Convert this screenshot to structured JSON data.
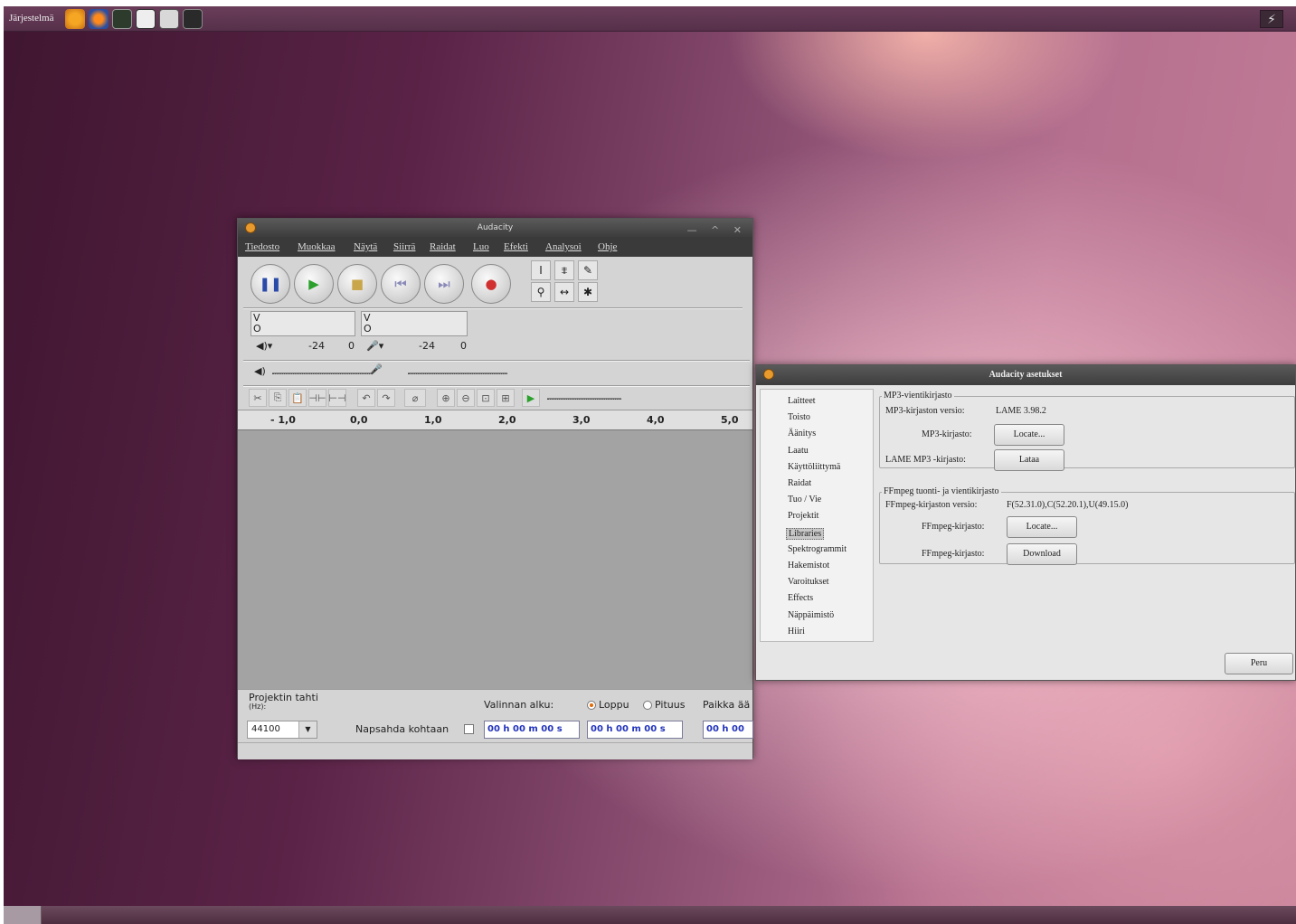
{
  "topbar": {
    "menu_label": "Järjestelmä",
    "tray_icon": "network-icon"
  },
  "audacity": {
    "title": "Audacity",
    "window_controls": "— ^ ✕",
    "menu": [
      "Tiedosto",
      "Muokkaa",
      "Näytä",
      "Siirrä",
      "Raidat",
      "Luo",
      "Efekti",
      "Analysoi",
      "Ohje"
    ],
    "transport": [
      "pause",
      "play",
      "stop",
      "skip-start",
      "skip-end",
      "record"
    ],
    "meter": {
      "v": "V",
      "o": "O",
      "m24": "-24",
      "zero": "0"
    },
    "ruler": [
      "- 1,0",
      "0,0",
      "1,0",
      "2,0",
      "3,0",
      "4,0",
      "5,0"
    ],
    "bottom": {
      "rate_label": "Projektin tahti",
      "rate_unit": "(Hz):",
      "rate_value": "44100",
      "snap_label": "Napsahda kohtaan",
      "selection_label": "Valinnan alku:",
      "radio_end": "Loppu",
      "radio_length": "Pituus",
      "audio_label": "Paikka ää",
      "time1": "00 h 00 m 00 s",
      "time2": "00 h 00 m 00 s",
      "time3": "00 h 00"
    }
  },
  "prefs": {
    "title": "Audacity asetukset",
    "categories": [
      "Laitteet",
      "Toisto",
      "Äänitys",
      "Laatu",
      "Käyttöliittymä",
      "Raidat",
      "Tuo / Vie",
      "Projektit",
      "Libraries",
      "Spektrogrammit",
      "Hakemistot",
      "Varoitukset",
      "Effects",
      "Näppäimistö",
      "Hiiri"
    ],
    "selected_index": 8,
    "mp3": {
      "group_title": "MP3-vientikirjasto",
      "version_label": "MP3-kirjaston versio:",
      "version_value": "LAME 3.98.2",
      "lib_label": "MP3-kirjasto:",
      "locate_btn": "Locate...",
      "lame_label": "LAME MP3 -kirjasto:",
      "download_btn": "Lataa"
    },
    "ffmpeg": {
      "group_title": "FFmpeg tuonti- ja vientikirjasto",
      "version_label": "FFmpeg-kirjaston versio:",
      "version_value": "F(52.31.0),C(52.20.1),U(49.15.0)",
      "lib_label1": "FFmpeg-kirjasto:",
      "locate_btn": "Locate...",
      "lib_label2": "FFmpeg-kirjasto:",
      "download_btn": "Download"
    },
    "cancel_btn": "Peru"
  },
  "colors": {
    "desktop_accent": "#8a4e71",
    "record": "#d03030",
    "play": "#2ca02c"
  }
}
